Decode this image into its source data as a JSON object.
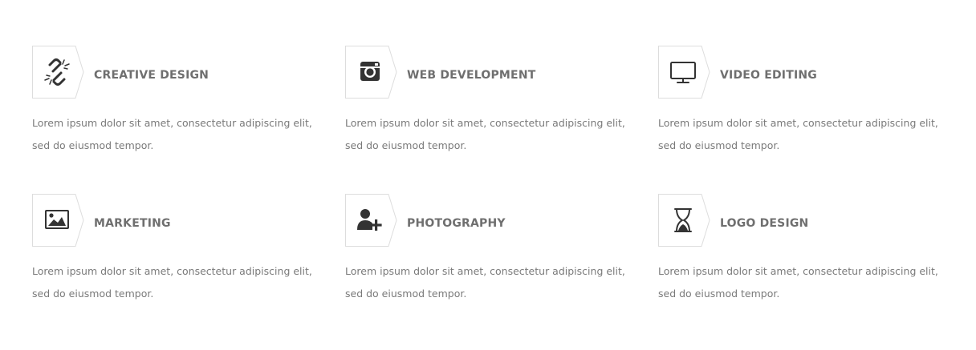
{
  "services": [
    {
      "title": "CREATIVE DESIGN",
      "text": "Lorem ipsum dolor sit amet, consectetur adipiscing elit, sed do eiusmod tempor.",
      "icon": "broken-link-icon"
    },
    {
      "title": "WEB DEVELOPMENT",
      "text": "Lorem ipsum dolor sit amet, consectetur adipiscing elit, sed do eiusmod tempor.",
      "icon": "instagram-icon"
    },
    {
      "title": "VIDEO EDITING",
      "text": "Lorem ipsum dolor sit amet, consectetur adipiscing elit, sed do eiusmod tempor.",
      "icon": "monitor-icon"
    },
    {
      "title": "MARKETING",
      "text": "Lorem ipsum dolor sit amet, consectetur adipiscing elit, sed do eiusmod tempor.",
      "icon": "image-icon"
    },
    {
      "title": "PHOTOGRAPHY",
      "text": "Lorem ipsum dolor sit amet, consectetur adipiscing elit, sed do eiusmod tempor.",
      "icon": "add-user-icon"
    },
    {
      "title": "LOGO DESIGN",
      "text": "Lorem ipsum dolor sit amet, consectetur adipiscing elit, sed do eiusmod tempor.",
      "icon": "hourglass-icon"
    }
  ],
  "colors": {
    "title": "#6f6f6f",
    "text": "#7a7a7a",
    "icon": "#333333",
    "frame": "#dddddd"
  }
}
